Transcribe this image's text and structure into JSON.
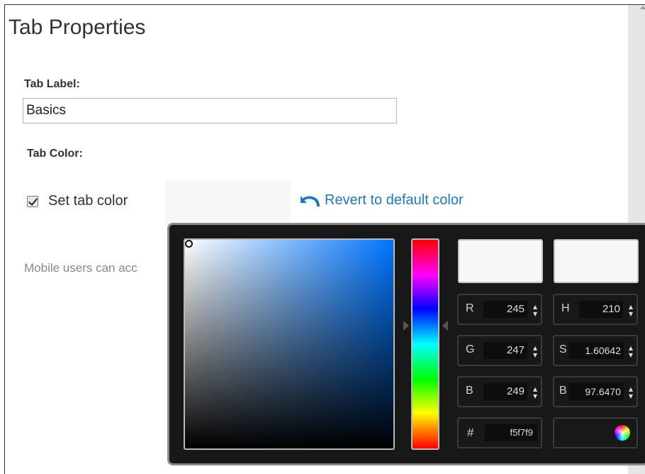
{
  "page": {
    "title": "Tab Properties",
    "tab_label_heading": "Tab Label:",
    "tab_label_value": "Basics",
    "tab_color_heading": "Tab Color:",
    "set_tab_color_label": "Set tab color",
    "set_tab_color_checked": true,
    "revert_label": "Revert to default color",
    "mobile_note": "Mobile users can acc",
    "swatch_color": "#f5f7f9",
    "accent_color": "#1c79c8"
  },
  "picker": {
    "new_color": "#f5f7f9",
    "current_color": "#f5f7f9",
    "fields": {
      "r": {
        "label": "R",
        "value": "245"
      },
      "g": {
        "label": "G",
        "value": "247"
      },
      "b": {
        "label": "B",
        "value": "249"
      },
      "h": {
        "label": "H",
        "value": "210"
      },
      "s": {
        "label": "S",
        "value": "1.60642"
      },
      "br": {
        "label": "B",
        "value": "97.6470"
      }
    },
    "hex": {
      "label": "#",
      "value": "f5f7f9"
    },
    "spinner_glyph": "⬍"
  }
}
